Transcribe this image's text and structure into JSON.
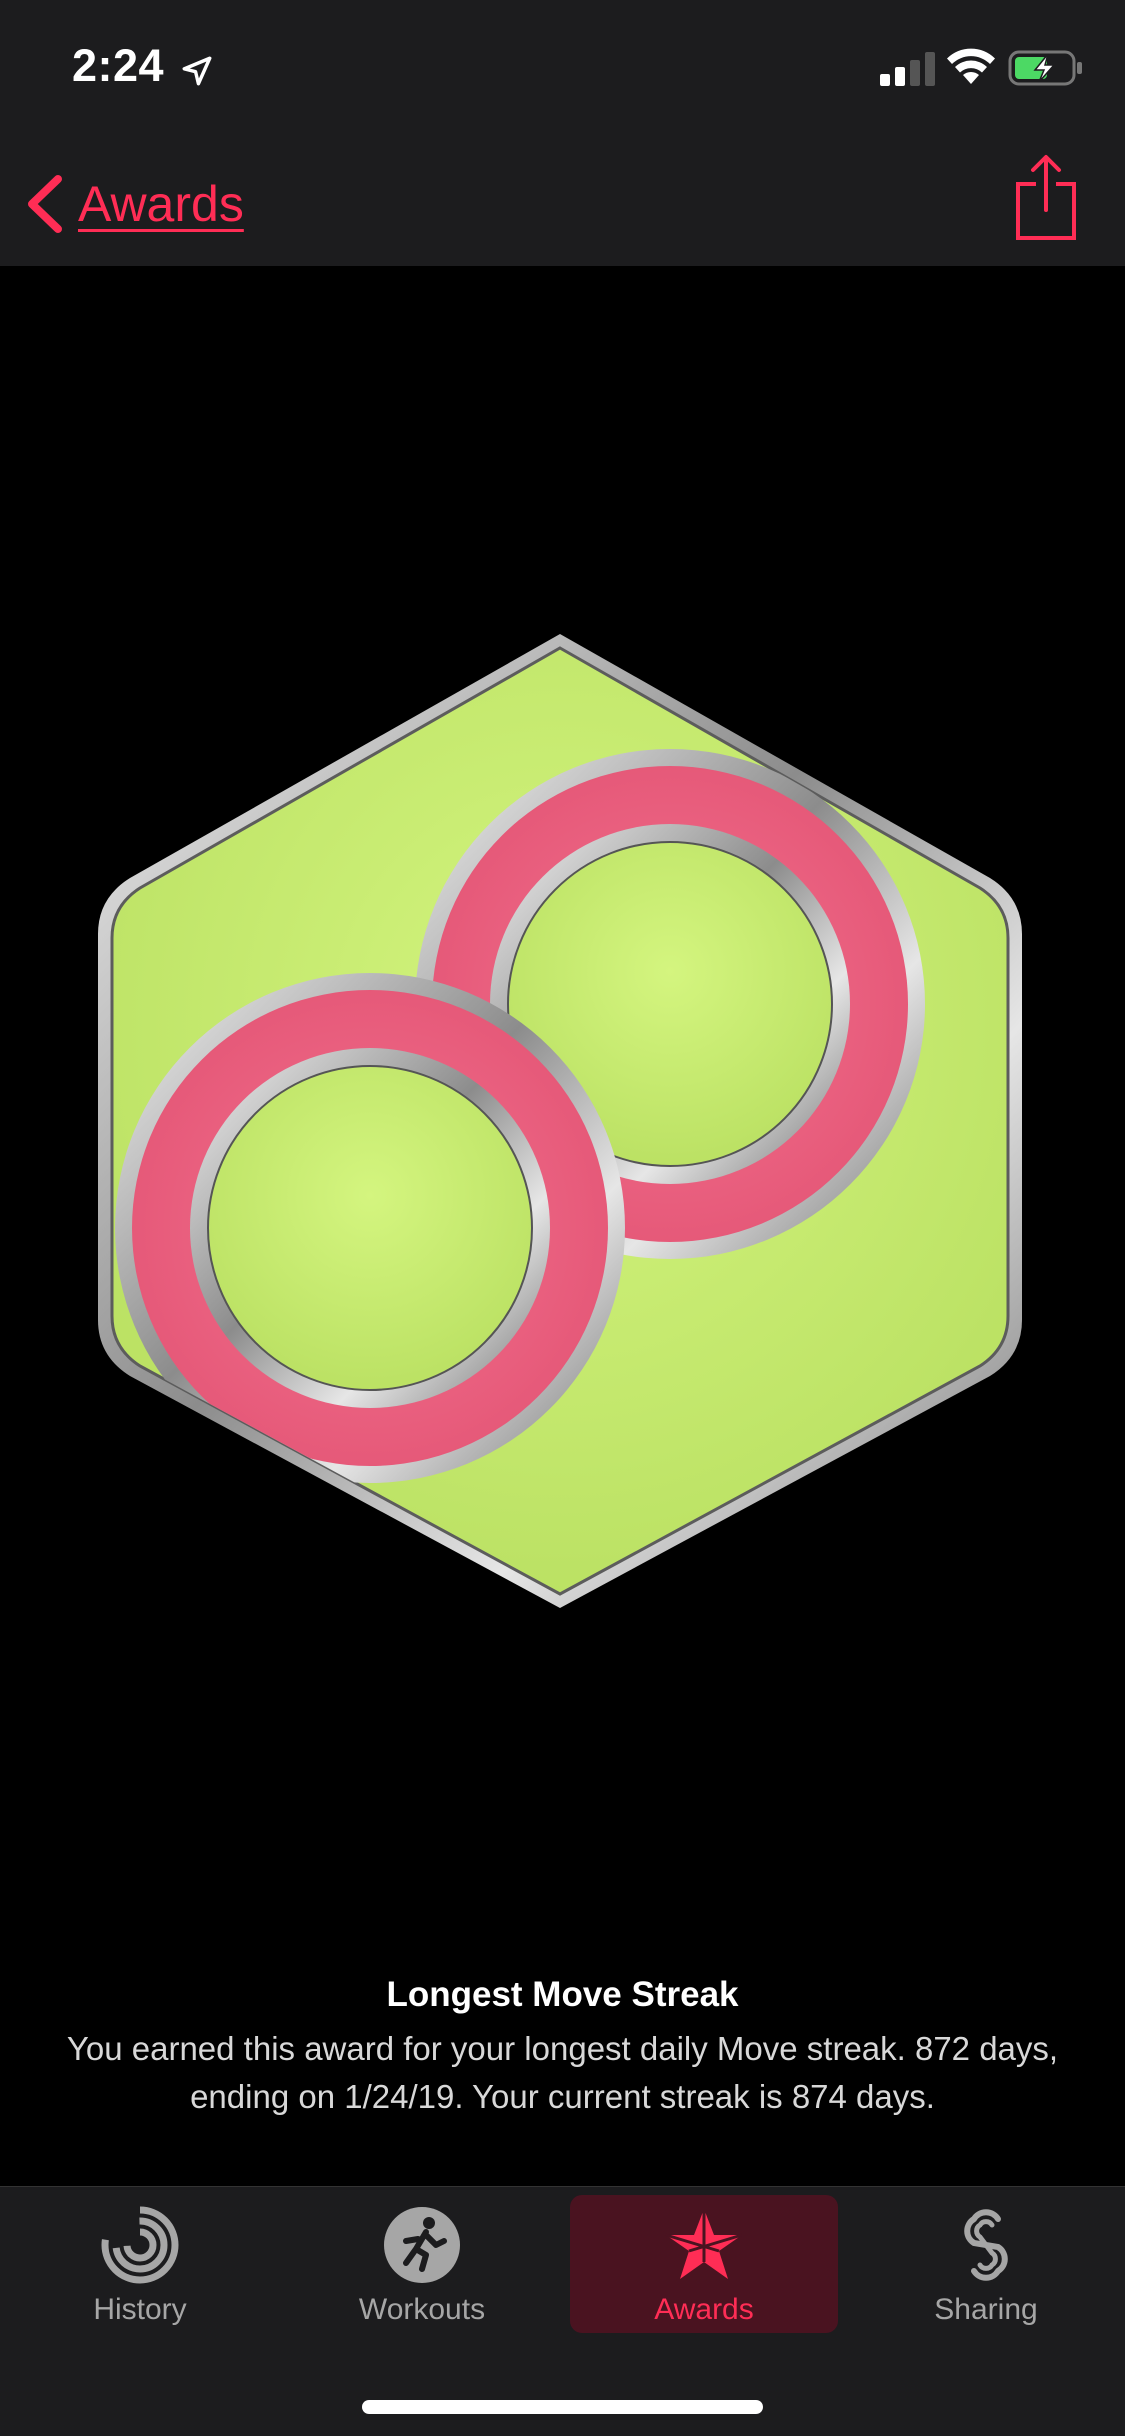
{
  "status_bar": {
    "time": "2:24",
    "icons": [
      "location-arrow-icon",
      "cellular-signal-icon",
      "wifi-icon",
      "battery-charging-icon"
    ]
  },
  "nav": {
    "back_label": "Awards",
    "share_icon": "share-icon"
  },
  "award": {
    "title": "Longest Move Streak",
    "description": "You earned this award for your longest daily Move streak. 872 days, ending on 1/24/19. Your current streak is 874 days.",
    "medal_icon": "infinity-streak-medal"
  },
  "tabs": [
    {
      "label": "History",
      "icon": "history-rings-icon",
      "active": false
    },
    {
      "label": "Workouts",
      "icon": "running-figure-icon",
      "active": false
    },
    {
      "label": "Awards",
      "icon": "award-star-icon",
      "active": true
    },
    {
      "label": "Sharing",
      "icon": "sharing-icon",
      "active": false
    }
  ],
  "colors": {
    "accent": "#ff2d55",
    "bar_background": "#1c1c1e",
    "medal_green": "#c8f070",
    "medal_pink": "#ee5f7e",
    "active_tab_bg": "#4a1320"
  }
}
